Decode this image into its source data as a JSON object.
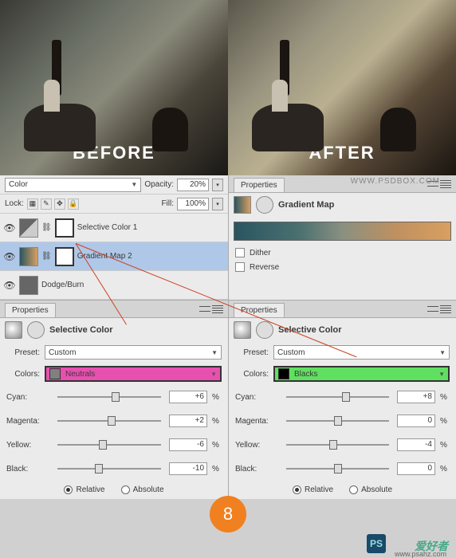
{
  "images": {
    "before_label": "BEFORE",
    "after_label": "AFTER"
  },
  "watermark_top": "WWW.PSDBOX.COM",
  "layers": {
    "blend_mode": "Color",
    "opacity_label": "Opacity:",
    "opacity_value": "20%",
    "lock_label": "Lock:",
    "fill_label": "Fill:",
    "fill_value": "100%",
    "rows": [
      {
        "name": "Selective Color 1"
      },
      {
        "name": "Gradient Map 2"
      },
      {
        "name": "Dodge/Burn"
      }
    ]
  },
  "props_right_top": {
    "tab": "Properties",
    "title": "Gradient Map",
    "dither": "Dither",
    "reverse": "Reverse"
  },
  "sel_left": {
    "tab": "Properties",
    "title": "Selective Color",
    "preset_label": "Preset:",
    "preset_value": "Custom",
    "colors_label": "Colors:",
    "colors_value": "Neutrals",
    "sliders": [
      {
        "label": "Cyan:",
        "value": "+6",
        "pos": 56
      },
      {
        "label": "Magenta:",
        "value": "+2",
        "pos": 52
      },
      {
        "label": "Yellow:",
        "value": "-6",
        "pos": 44
      },
      {
        "label": "Black:",
        "value": "-10",
        "pos": 40
      }
    ],
    "relative": "Relative",
    "absolute": "Absolute"
  },
  "sel_right": {
    "tab": "Properties",
    "title": "Selective Color",
    "preset_label": "Preset:",
    "preset_value": "Custom",
    "colors_label": "Colors:",
    "colors_value": "Blacks",
    "sliders": [
      {
        "label": "Cyan:",
        "value": "+8",
        "pos": 58
      },
      {
        "label": "Magenta:",
        "value": "0",
        "pos": 50
      },
      {
        "label": "Yellow:",
        "value": "-4",
        "pos": 46
      },
      {
        "label": "Black:",
        "value": "0",
        "pos": 50
      }
    ],
    "relative": "Relative",
    "absolute": "Absolute"
  },
  "badge": "8",
  "wm_text": "爱好者",
  "wm_url": "www.psahz.com"
}
